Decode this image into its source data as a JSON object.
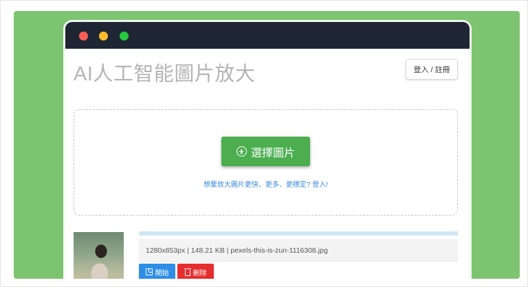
{
  "page": {
    "title": "AI人工智能圖片放大",
    "login_label": "登入 / 註冊"
  },
  "upload": {
    "select_label": "選擇圖片",
    "promo_text": "想要放大圖片更快、更多、更穩定? 登入!"
  },
  "file": {
    "info": "1280x853px | 148.21 KB | pexels-this-is-zun-1116308.jpg",
    "start_label": "開始",
    "delete_label": "刪除",
    "progress": 1.0
  },
  "icons": {
    "window_controls": [
      "close-dot-icon",
      "minimize-dot-icon",
      "maximize-dot-icon"
    ],
    "select": "plus-circle-icon",
    "start": "expand-icon",
    "delete": "trash-icon"
  },
  "colors": {
    "background_panel": "#7dc470",
    "titlebar": "#1e2634",
    "select_button": "#4cae4f",
    "start_button": "#2e8ee6",
    "delete_button": "#e52e2e",
    "link": "#3a8ad8"
  }
}
